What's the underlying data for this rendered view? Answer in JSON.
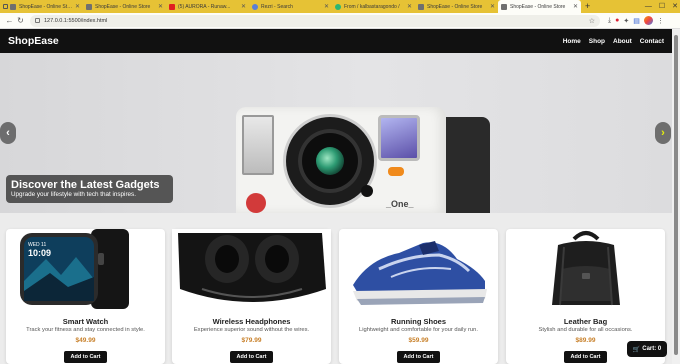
{
  "browser": {
    "tabs": [
      {
        "title": "ShopEase - Online Store",
        "favicon": "page-icon"
      },
      {
        "title": "ShopEase - Online Store",
        "favicon": "page-icon"
      },
      {
        "title": "(5) AURORA - Runaw...",
        "favicon": "youtube-icon"
      },
      {
        "title": "Rezri - Search",
        "favicon": "search-icon"
      },
      {
        "title": "From / kalbastaragondo /",
        "favicon": "green-icon"
      },
      {
        "title": "ShopEase - Online Store",
        "favicon": "page-icon"
      },
      {
        "title": "ShopEase - Online Store",
        "favicon": "page-icon",
        "active": true
      }
    ],
    "new_tab": "+",
    "url": "127.0.0.1:5500/index.html"
  },
  "site": {
    "logo": "ShopEase",
    "nav": [
      "Home",
      "Shop",
      "About",
      "Contact"
    ]
  },
  "hero": {
    "title": "Discover the Latest Gadgets",
    "subtitle": "Upgrade your lifestyle with tech that inspires.",
    "prev": "‹",
    "next": "›",
    "camera_text": "_One_"
  },
  "products": [
    {
      "name": "Smart Watch",
      "description": "Track your fitness and stay connected in style.",
      "price": "$49.99",
      "button": "Add to Cart",
      "watch_time": "10:09",
      "watch_date": "WED 11"
    },
    {
      "name": "Wireless Headphones",
      "description": "Experience superior sound without the wires.",
      "price": "$79.99",
      "button": "Add to Cart"
    },
    {
      "name": "Running Shoes",
      "description": "Lightweight and comfortable for your daily run.",
      "price": "$59.99",
      "button": "Add to Cart"
    },
    {
      "name": "Leather Bag",
      "description": "Stylish and durable for all occasions.",
      "price": "$89.99",
      "button": "Add to Cart"
    }
  ],
  "cart": {
    "label": "Cart: 0"
  },
  "colors": {
    "nav_bg": "#111111",
    "price": "#c8802a",
    "tabstrip": "#e6c235",
    "accent_arrow": "#e6f20a"
  }
}
